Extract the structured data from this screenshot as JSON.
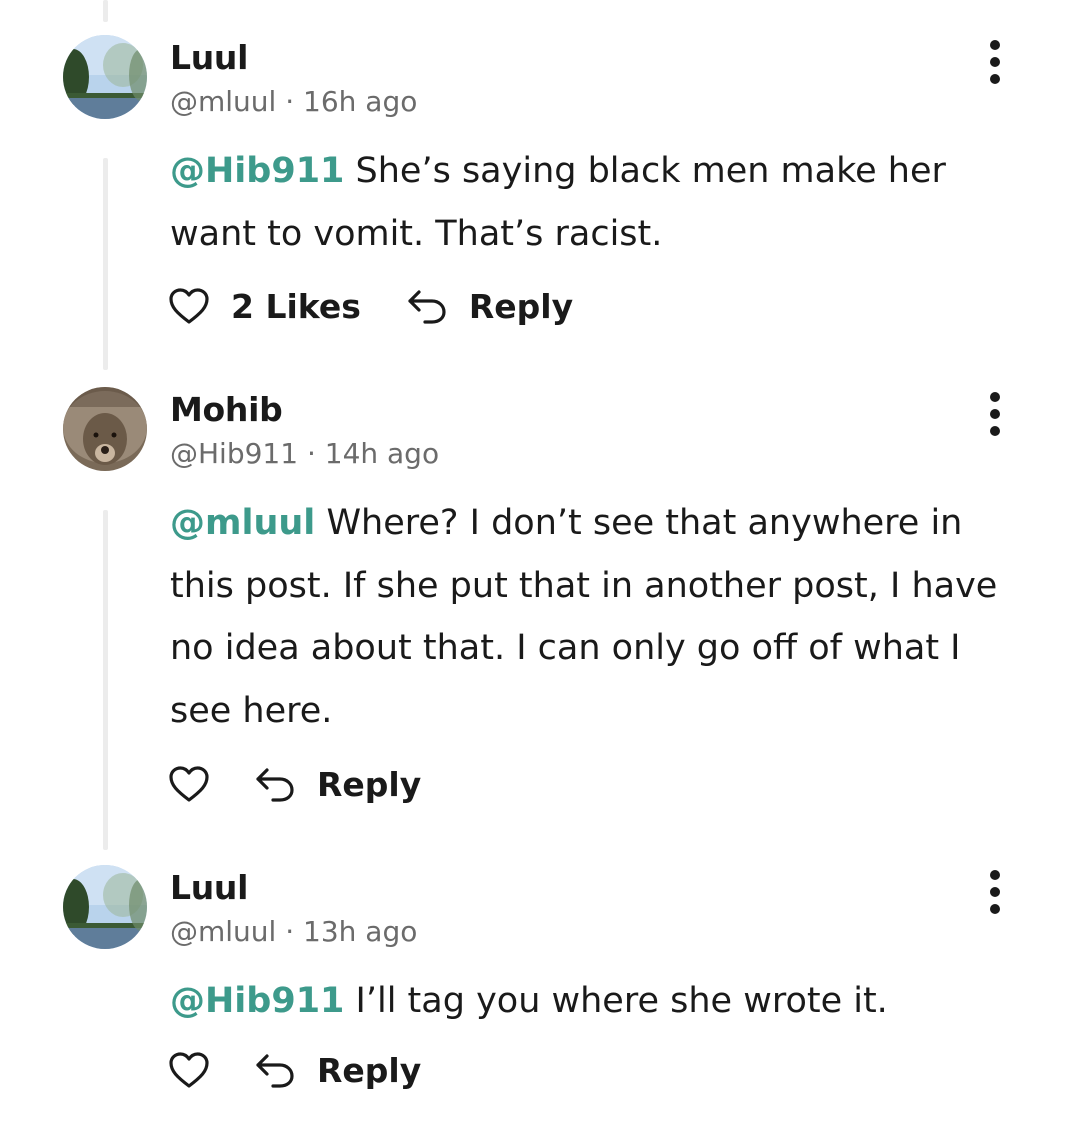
{
  "comments": [
    {
      "author": "Luul",
      "meta": "@mluul · 16h ago",
      "mention": "@Hib911",
      "text": " She’s saying black men make her want to vomit. That’s racist.",
      "likes_label": "2 Likes",
      "reply_label": "Reply"
    },
    {
      "author": "Mohib",
      "meta": "@Hib911 · 14h ago",
      "mention": "@mluul",
      "text": " Where? I don’t see that anywhere in this post. If she put that in another post, I have no idea about that. I can only go off of what I see here.",
      "likes_label": "",
      "reply_label": "Reply"
    },
    {
      "author": "Luul",
      "meta": "@mluul · 13h ago",
      "mention": "@Hib911",
      "text": " I’ll tag you where she wrote it.",
      "likes_label": "",
      "reply_label": "Reply"
    }
  ],
  "icons": {
    "like": "heart-icon",
    "reply": "reply-arrow-icon",
    "more": "more-vertical-icon"
  },
  "colors": {
    "mention": "#3d9a8b",
    "meta": "#6b6b6b",
    "text": "#1a1a1a",
    "thread_line": "#ececec"
  }
}
